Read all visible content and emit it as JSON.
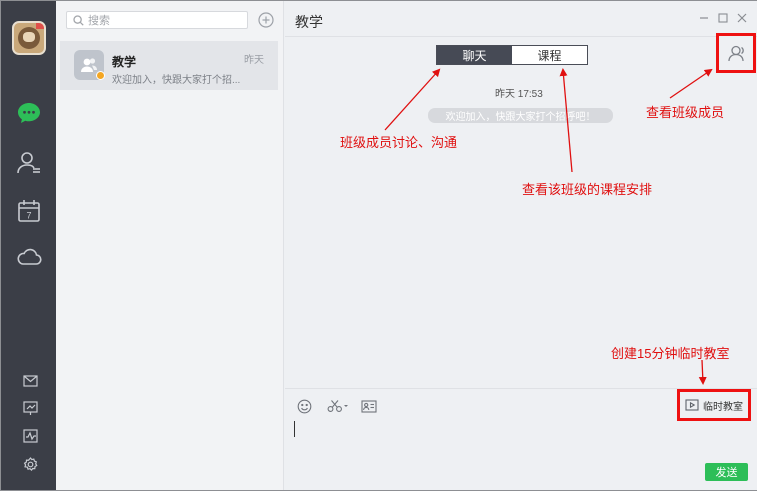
{
  "search": {
    "placeholder": "搜索",
    "icon": "search-icon"
  },
  "nav": {
    "items": [
      {
        "name": "chat",
        "icon": "chat-bubble-icon",
        "color": "#2dbe58"
      },
      {
        "name": "contacts",
        "icon": "contacts-icon"
      },
      {
        "name": "calendar",
        "icon": "calendar-icon",
        "day": "7"
      },
      {
        "name": "cloud",
        "icon": "cloud-icon"
      }
    ],
    "bottom": [
      {
        "name": "mail",
        "icon": "mail-icon"
      },
      {
        "name": "board",
        "icon": "whiteboard-icon"
      },
      {
        "name": "activity",
        "icon": "activity-icon"
      },
      {
        "name": "settings",
        "icon": "gear-icon"
      }
    ]
  },
  "conversations": [
    {
      "name": "教学",
      "time": "昨天",
      "preview": "欢迎加入，快跟大家打个招..."
    }
  ],
  "chat": {
    "title": "教学",
    "tabs": [
      "聊天",
      "课程"
    ],
    "active_tab": "聊天",
    "time_separator": "昨天 17:53",
    "system_message": "欢迎加入，快跟大家打个招呼吧！",
    "classroom_button": "临时教室",
    "send_button": "发送"
  },
  "annotations": {
    "discussion": "班级成员讨论、沟通",
    "schedule": "查看该班级的课程安排",
    "members": "查看班级成员",
    "classroom": "创建15分钟临时教室"
  },
  "colors": {
    "accent_green": "#2dbe58",
    "annotation_red": "#e01010",
    "rail_dark": "#3b3e47"
  }
}
